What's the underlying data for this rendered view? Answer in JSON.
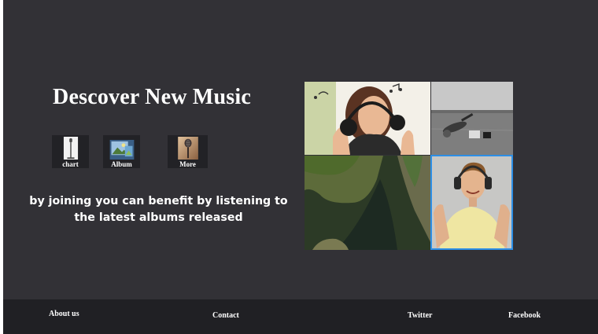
{
  "hero": {
    "title": "Descover New Music",
    "tagline": "by joining you can benefit by listening to the latest albums released"
  },
  "icons": [
    {
      "label": "chart",
      "icon": "microphone-stand-icon"
    },
    {
      "label": "Album",
      "icon": "photo-album-icon"
    },
    {
      "label": "More",
      "icon": "vintage-microphone-icon"
    }
  ],
  "collage": {
    "photos": [
      {
        "icon": "woman-headphones-photo"
      },
      {
        "icon": "person-lying-photo"
      },
      {
        "icon": "canyon-river-photo"
      },
      {
        "icon": "man-headphones-photo"
      }
    ],
    "highlight_color": "#2d8fe6"
  },
  "footer": {
    "about": "About us",
    "contact": "Contact",
    "twitter": "Twitter",
    "facebook": "Facebook"
  },
  "colors": {
    "background": "#323136",
    "footer": "#202024",
    "text": "#ffffff"
  }
}
